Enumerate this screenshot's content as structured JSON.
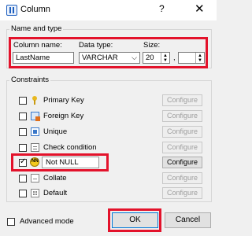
{
  "window": {
    "title": "Column",
    "help": "?",
    "close": "✕"
  },
  "name_type": {
    "group_label": "Name and type",
    "column_name_label": "Column name:",
    "column_name_value": "LastName",
    "data_type_label": "Data type:",
    "data_type_value": "VARCHAR",
    "size_label": "Size:",
    "size_value": "20",
    "separator": ",",
    "size2_value": ""
  },
  "constraints": {
    "group_label": "Constraints",
    "items": [
      {
        "label": "Primary Key",
        "icon": "key-icon",
        "checked": false,
        "configure": "Configure",
        "configure_enabled": false
      },
      {
        "label": "Foreign Key",
        "icon": "foreign-key-icon",
        "checked": false,
        "configure": "Configure",
        "configure_enabled": false
      },
      {
        "label": "Unique",
        "icon": "unique-icon",
        "checked": false,
        "configure": "Configure",
        "configure_enabled": false
      },
      {
        "label": "Check condition",
        "icon": "check-condition-icon",
        "checked": false,
        "configure": "Configure",
        "configure_enabled": false
      },
      {
        "label": "Not NULL",
        "icon": "not-null-icon",
        "checked": true,
        "configure": "Configure",
        "configure_enabled": true
      },
      {
        "label": "Collate",
        "icon": "collate-icon",
        "checked": false,
        "configure": "Configure",
        "configure_enabled": false
      },
      {
        "label": "Default",
        "icon": "default-icon",
        "checked": false,
        "configure": "Configure",
        "configure_enabled": false
      }
    ]
  },
  "footer": {
    "advanced_mode_label": "Advanced mode",
    "ok_label": "OK",
    "cancel_label": "Cancel"
  },
  "colors": {
    "highlight": "#e3122b",
    "accent": "#1e5fbf"
  }
}
